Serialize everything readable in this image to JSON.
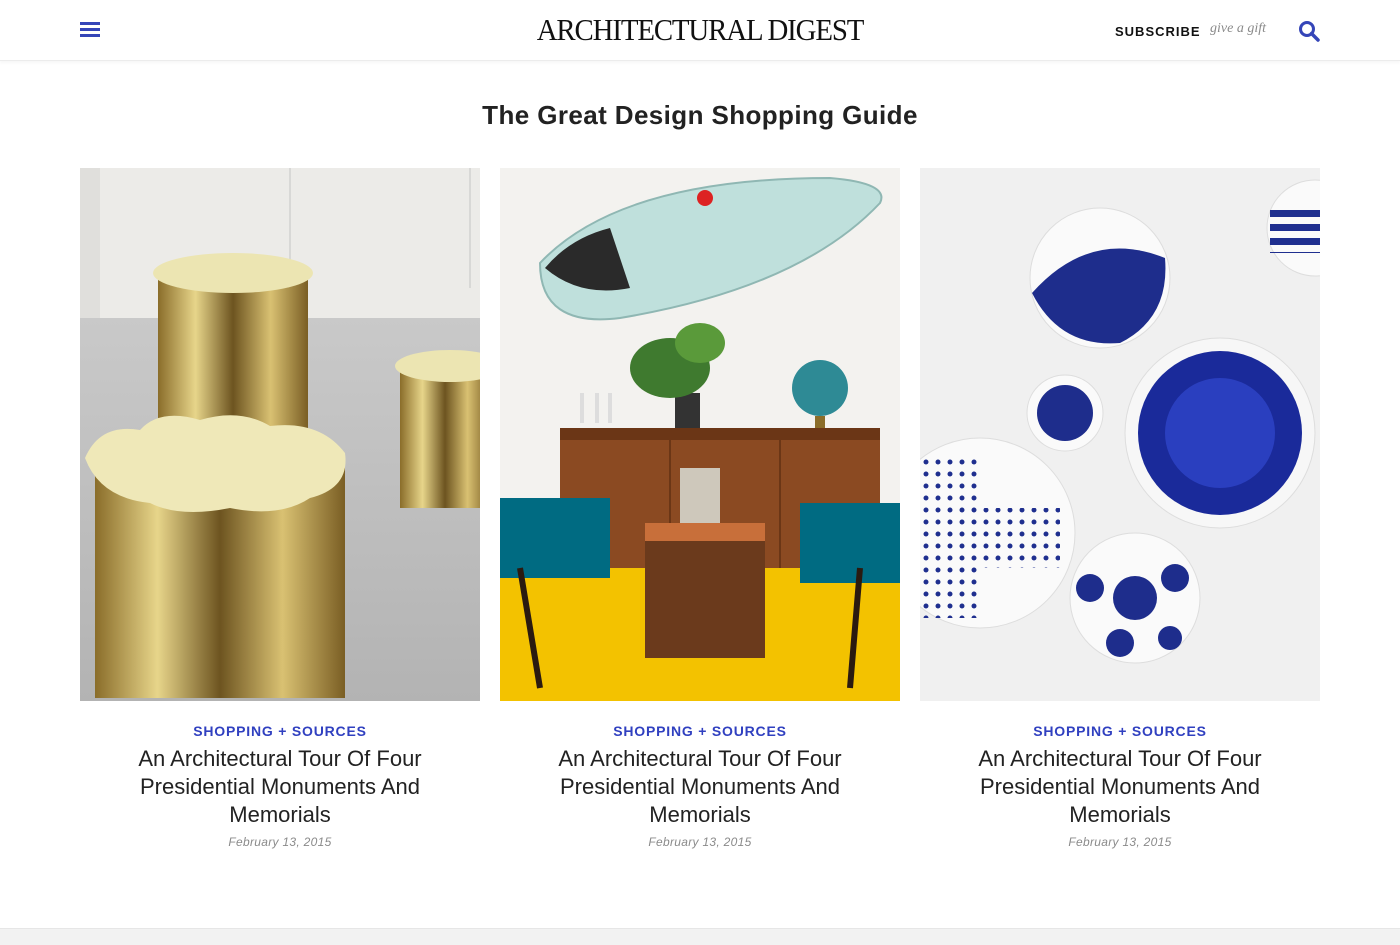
{
  "header": {
    "logo": "ARCHITECTURAL DIGEST",
    "subscribe": "SUBSCRIBE",
    "gift": "give a gift",
    "menu_icon": "hamburger-icon",
    "search_icon": "search-icon",
    "accent_color": "#3545b8"
  },
  "section": {
    "title": "The Great Design Shopping Guide"
  },
  "cards": [
    {
      "category": "SHOPPING + SOURCES",
      "headline": "An Architectural Tour Of Four Presidential Monuments And Memorials",
      "date": "February 13, 2015"
    },
    {
      "category": "SHOPPING + SOURCES",
      "headline": "An Architectural Tour Of Four Presidential Monuments And Memorials",
      "date": "February 13, 2015"
    },
    {
      "category": "SHOPPING + SOURCES",
      "headline": "An Architectural Tour Of Four Presidential Monuments And Memorials",
      "date": "February 13, 2015"
    }
  ]
}
